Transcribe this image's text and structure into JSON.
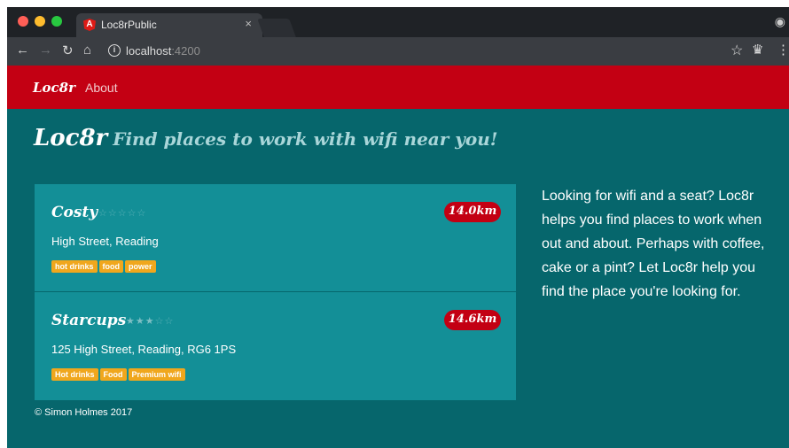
{
  "browser": {
    "tab_title": "Loc8rPublic",
    "tab_close": "×",
    "favicon_letter": "A",
    "url_host": "localhost",
    "url_port": ":4200",
    "colors": {
      "close": "#ff5f57",
      "minimize": "#febc2e",
      "maximize": "#28c840"
    }
  },
  "navbar": {
    "brand": "Loc8r",
    "links": [
      "About"
    ]
  },
  "page_header": {
    "title": "Loc8r",
    "tagline": "Find places to work with wifi near you!"
  },
  "locations": [
    {
      "name": "Costy",
      "rating": 0,
      "distance": "14.0km",
      "address": "High Street, Reading",
      "facilities": [
        "hot drinks",
        "food",
        "power"
      ]
    },
    {
      "name": "Starcups",
      "rating": 3,
      "distance": "14.6km",
      "address": "125 High Street, Reading, RG6 1PS",
      "facilities": [
        "Hot drinks",
        "Food",
        "Premium wifi"
      ]
    }
  ],
  "sidebar": {
    "text": "Looking for wifi and a seat? Loc8r helps you find places to work when out and about. Perhaps with coffee, cake or a pint? Let Loc8r help you find the place you're looking for."
  },
  "footer": {
    "text": "© Simon Holmes 2017"
  },
  "theme": {
    "navbar": "#c30013",
    "background": "#06666c",
    "card": "#138f97",
    "tag": "#f0a71d"
  }
}
